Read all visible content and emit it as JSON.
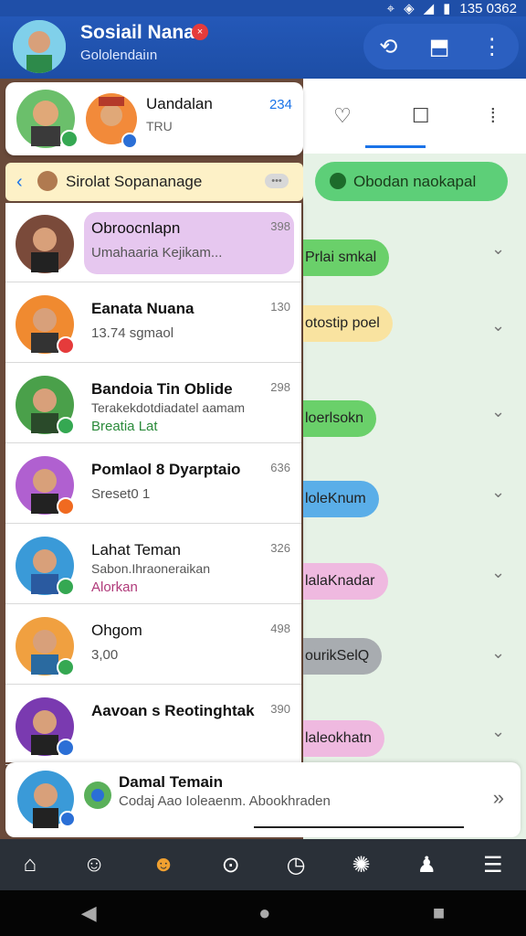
{
  "status": {
    "time": "135 0362",
    "icons": [
      "location-icon",
      "wifi-icon",
      "signal-icon",
      "battery-icon"
    ]
  },
  "appbar": {
    "title": "Sosiail Nana",
    "subtitle": "Gololendaiın",
    "actions": [
      "sync-icon",
      "notification-icon",
      "more-icon"
    ]
  },
  "top_card": {
    "name": "Uandalan",
    "sub": "TRU",
    "count": "234"
  },
  "tabs": [
    "heart-icon",
    "message-icon",
    "apps-icon"
  ],
  "banner": {
    "label": "Sirolat Sopananage"
  },
  "green_button": "Obodan naokapal",
  "chats": [
    {
      "name": "Obroocnlapn",
      "time": "398",
      "msg": "Umahaaria Kejikam...",
      "highlight": true
    },
    {
      "name": "Eanata Nuana",
      "time": "130",
      "msg": "13.74 sgmaol"
    },
    {
      "name": "Bandoia Tin Oblide",
      "time": "298",
      "sub": "Terakekdotdiadatel aamam",
      "tags": "Breatia   Lat"
    },
    {
      "name": "Pomlaol 8 Dyarptaio",
      "time": "636",
      "msg": "Sreset0 1"
    },
    {
      "name": "Lahat Teman",
      "time": "326",
      "sub": "Sabon.Ihraoneraikan",
      "tags": "Alorkan"
    },
    {
      "name": "Ohgom",
      "time": "498",
      "msg": "3,00"
    },
    {
      "name": "Aavoan s Reotinghtak",
      "time": "390",
      "msg": ""
    }
  ],
  "right_chips": [
    "Prlai smkal",
    "otostip poel",
    "loerlsokn",
    "loleKnum",
    "lalaKnadar",
    "ourikSelQ",
    "laleokhatn"
  ],
  "bottom_card": {
    "name": "Damal Temain",
    "msg": "Codaj Aao Ioleaenm. Abookhraden"
  },
  "colors": {
    "appbar": "#2458b8",
    "accent": "#1a73e8"
  }
}
